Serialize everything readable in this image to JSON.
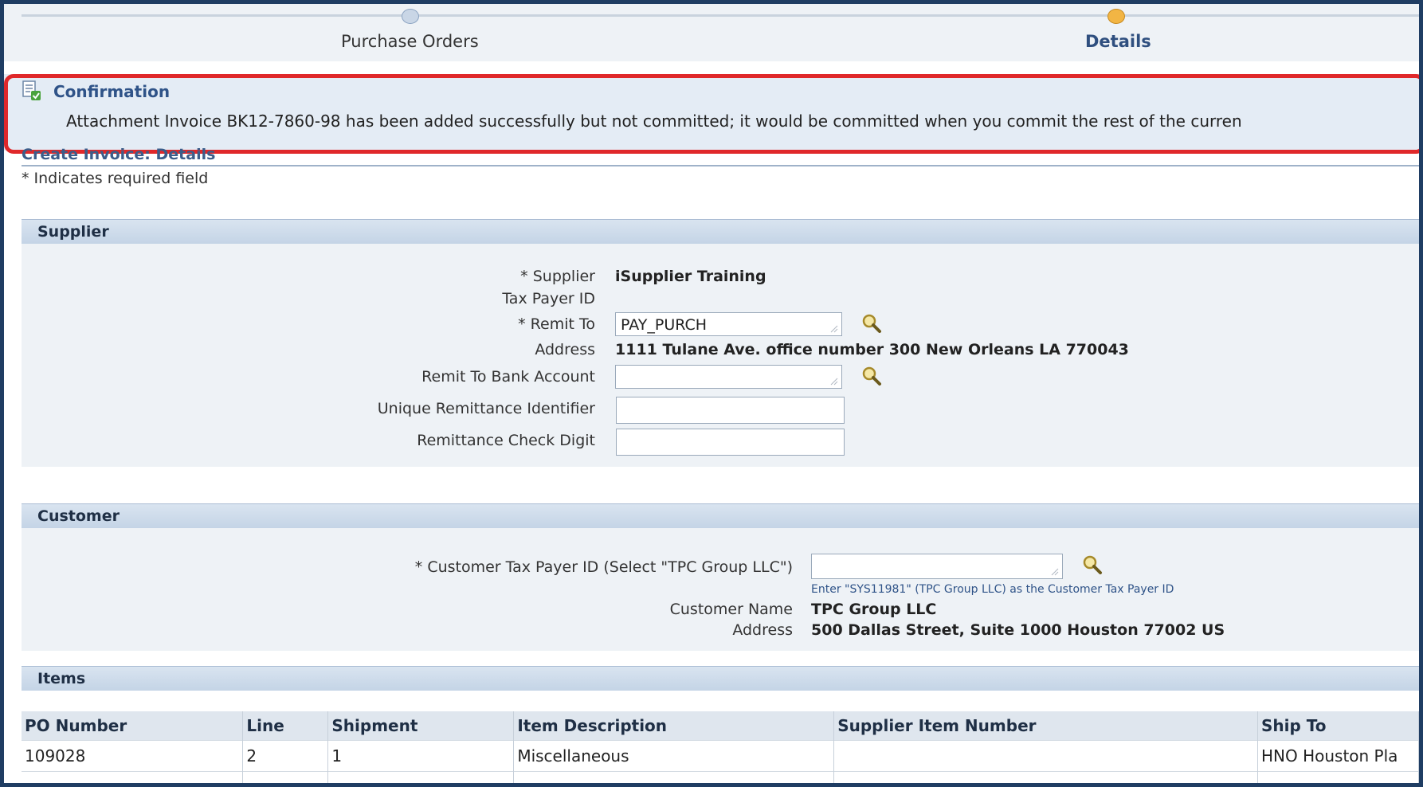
{
  "train": {
    "steps": [
      {
        "label": "Purchase Orders",
        "state": "visited"
      },
      {
        "label": "Details",
        "state": "current"
      }
    ]
  },
  "confirmation": {
    "title": "Confirmation",
    "message": "Attachment Invoice BK12-7860-98 has been added successfully but not committed; it would be committed when you commit the rest of the curren",
    "icon": "confirmation-document-icon"
  },
  "page": {
    "title": "Create Invoice: Details",
    "required_note": "* Indicates required field"
  },
  "supplier": {
    "section_title": "Supplier",
    "supplier_label": "* Supplier",
    "supplier_value": "iSupplier Training",
    "taxpayer_label": "Tax Payer ID",
    "remit_to_label": "* Remit To",
    "remit_to_value": "PAY_PURCH",
    "address_label": "Address",
    "address_value": "1111 Tulane Ave. office number 300 New Orleans LA 770043",
    "bank_account_label": "Remit To Bank Account",
    "bank_account_value": "",
    "unique_remit_label": "Unique Remittance Identifier",
    "unique_remit_value": "",
    "check_digit_label": "Remittance Check Digit",
    "check_digit_value": ""
  },
  "customer": {
    "section_title": "Customer",
    "taxpayer_label": "* Customer Tax Payer ID (Select \"TPC Group LLC\")",
    "taxpayer_value": "",
    "hint": "Enter \"SYS11981\" (TPC Group LLC) as the Customer Tax Payer ID",
    "name_label": "Customer Name",
    "name_value": "TPC Group LLC",
    "address_label": "Address",
    "address_value": "500 Dallas Street, Suite 1000 Houston 77002 US"
  },
  "items": {
    "section_title": "Items",
    "columns": [
      "PO Number",
      "Line",
      "Shipment",
      "Item Description",
      "Supplier Item Number",
      "Ship To"
    ],
    "rows": [
      [
        "109028",
        "2",
        "1",
        "Miscellaneous",
        "",
        "HNO Houston Pla"
      ]
    ]
  },
  "colors": {
    "accent": "#2f5388",
    "highlight_outline": "#e0282a",
    "frame": "#1f3d63"
  }
}
